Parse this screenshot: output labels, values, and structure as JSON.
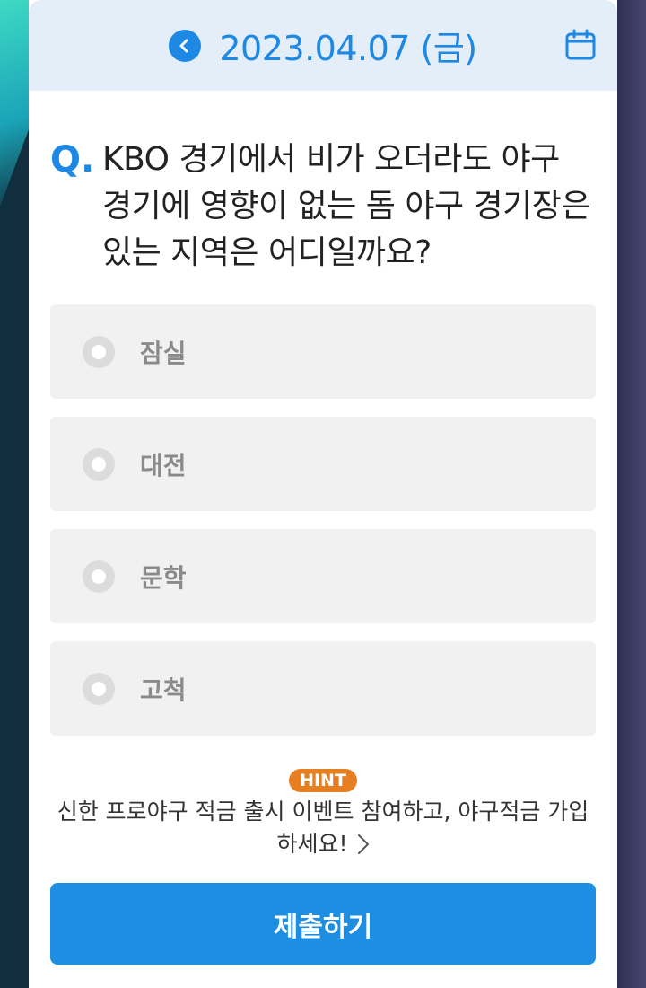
{
  "header": {
    "date": "2023.04.07 (금)",
    "prev_icon": "chevron-left-icon",
    "calendar_icon": "calendar-icon"
  },
  "question": {
    "prefix": "Q.",
    "text": "KBO 경기에서 비가 오더라도 야구 경기에 영향이 없는 돔 야구 경기장은 있는 지역은 어디일까요?"
  },
  "options": [
    {
      "label": "잠실"
    },
    {
      "label": "대전"
    },
    {
      "label": "문학"
    },
    {
      "label": "고척"
    }
  ],
  "hint": {
    "badge": "HINT",
    "text_line1": "신한 프로야구 적금 출시 이벤트 참여하고, 야구적금 가입",
    "text_line2": "하세요!"
  },
  "submit": {
    "label": "제출하기"
  },
  "colors": {
    "accent": "#1e88e5",
    "header_bg": "#e3eef8",
    "option_bg": "#f1f1f1",
    "hint_badge": "#e67e22"
  }
}
